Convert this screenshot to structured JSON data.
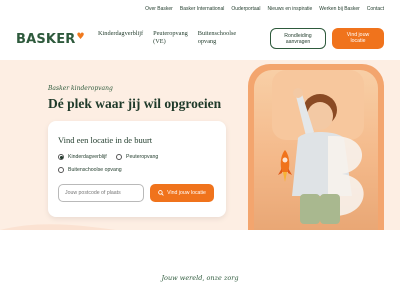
{
  "top_links": [
    "Over Basker",
    "Basker International",
    "Ouderportaal",
    "Nieuws en inspiratie",
    "Werken bij Basker",
    "Contact"
  ],
  "logo": {
    "text": "BASKER"
  },
  "nav": [
    {
      "line1": "Kinderdagverblijf",
      "line2": ""
    },
    {
      "line1": "Peuteropvang",
      "line2": "(VE)"
    },
    {
      "line1": "Buitenschoolse",
      "line2": "opvang"
    }
  ],
  "header_buttons": {
    "tour": {
      "line1": "Rondleiding",
      "line2": "aanvragen"
    },
    "find": {
      "line1": "Vind jouw",
      "line2": "locatie"
    }
  },
  "hero": {
    "eyebrow": "Basker kinderopvang",
    "title": "Dé plek waar jij wil opgroeien"
  },
  "search_card": {
    "title": "Vind een locatie in de buurt",
    "options": [
      "Kinderdagverblijf",
      "Peuteropvang",
      "Buitenschoolse opvang"
    ],
    "selected": "Kinderdagverblijf",
    "postcode_placeholder": "Jouw postcode of plaats",
    "button_label": "Vind jouw locatie"
  },
  "tagline": "Jouw wereld, onze zorg",
  "colors": {
    "brand_green": "#2e5a3c",
    "accent_orange": "#f0731c",
    "hero_bg": "#fdeee3"
  }
}
